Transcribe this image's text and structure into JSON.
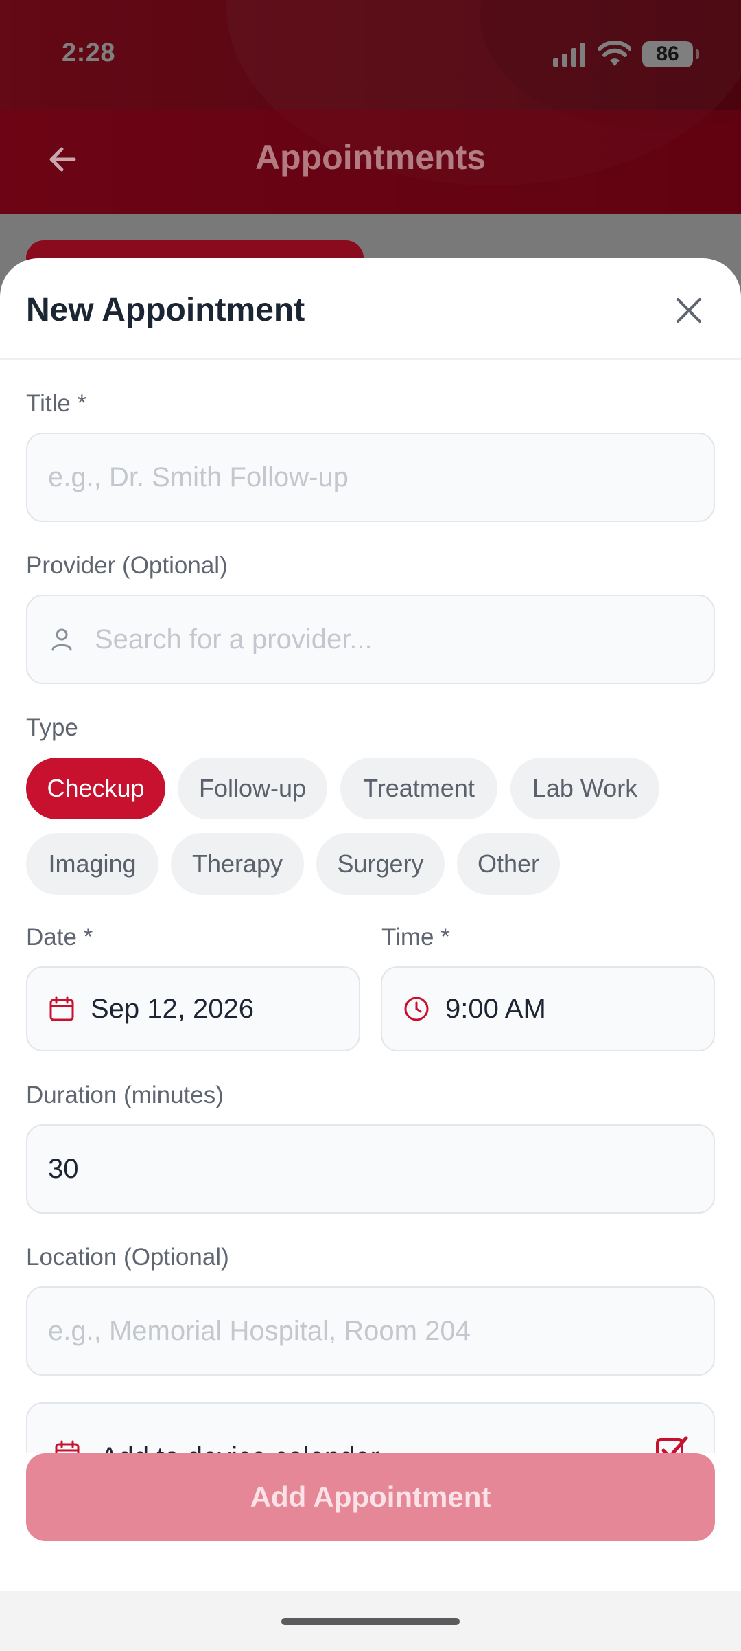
{
  "status_bar": {
    "time": "2:28",
    "battery": "86"
  },
  "nav": {
    "title": "Appointments"
  },
  "sheet": {
    "title": "New Appointment",
    "title_field": {
      "label": "Title *",
      "placeholder": "e.g., Dr. Smith Follow-up"
    },
    "provider_field": {
      "label": "Provider (Optional)",
      "placeholder": "Search for a provider..."
    },
    "type_field": {
      "label": "Type",
      "options": [
        "Checkup",
        "Follow-up",
        "Treatment",
        "Lab Work",
        "Imaging",
        "Therapy",
        "Surgery",
        "Other"
      ],
      "selected": "Checkup"
    },
    "date_field": {
      "label": "Date *",
      "value": "Sep 12, 2026"
    },
    "time_field": {
      "label": "Time *",
      "value": "9:00 AM"
    },
    "duration_field": {
      "label": "Duration (minutes)",
      "value": "30"
    },
    "location_field": {
      "label": "Location (Optional)",
      "placeholder": "e.g., Memorial Hospital, Room 204"
    },
    "calendar_toggle": {
      "label": "Add to device calendar",
      "checked": true
    },
    "submit_label": "Add Appointment"
  },
  "colors": {
    "brand": "#c8112e",
    "brand_disabled": "#e58797",
    "text_dark": "#1c2533",
    "placeholder": "#c4c8ce"
  }
}
